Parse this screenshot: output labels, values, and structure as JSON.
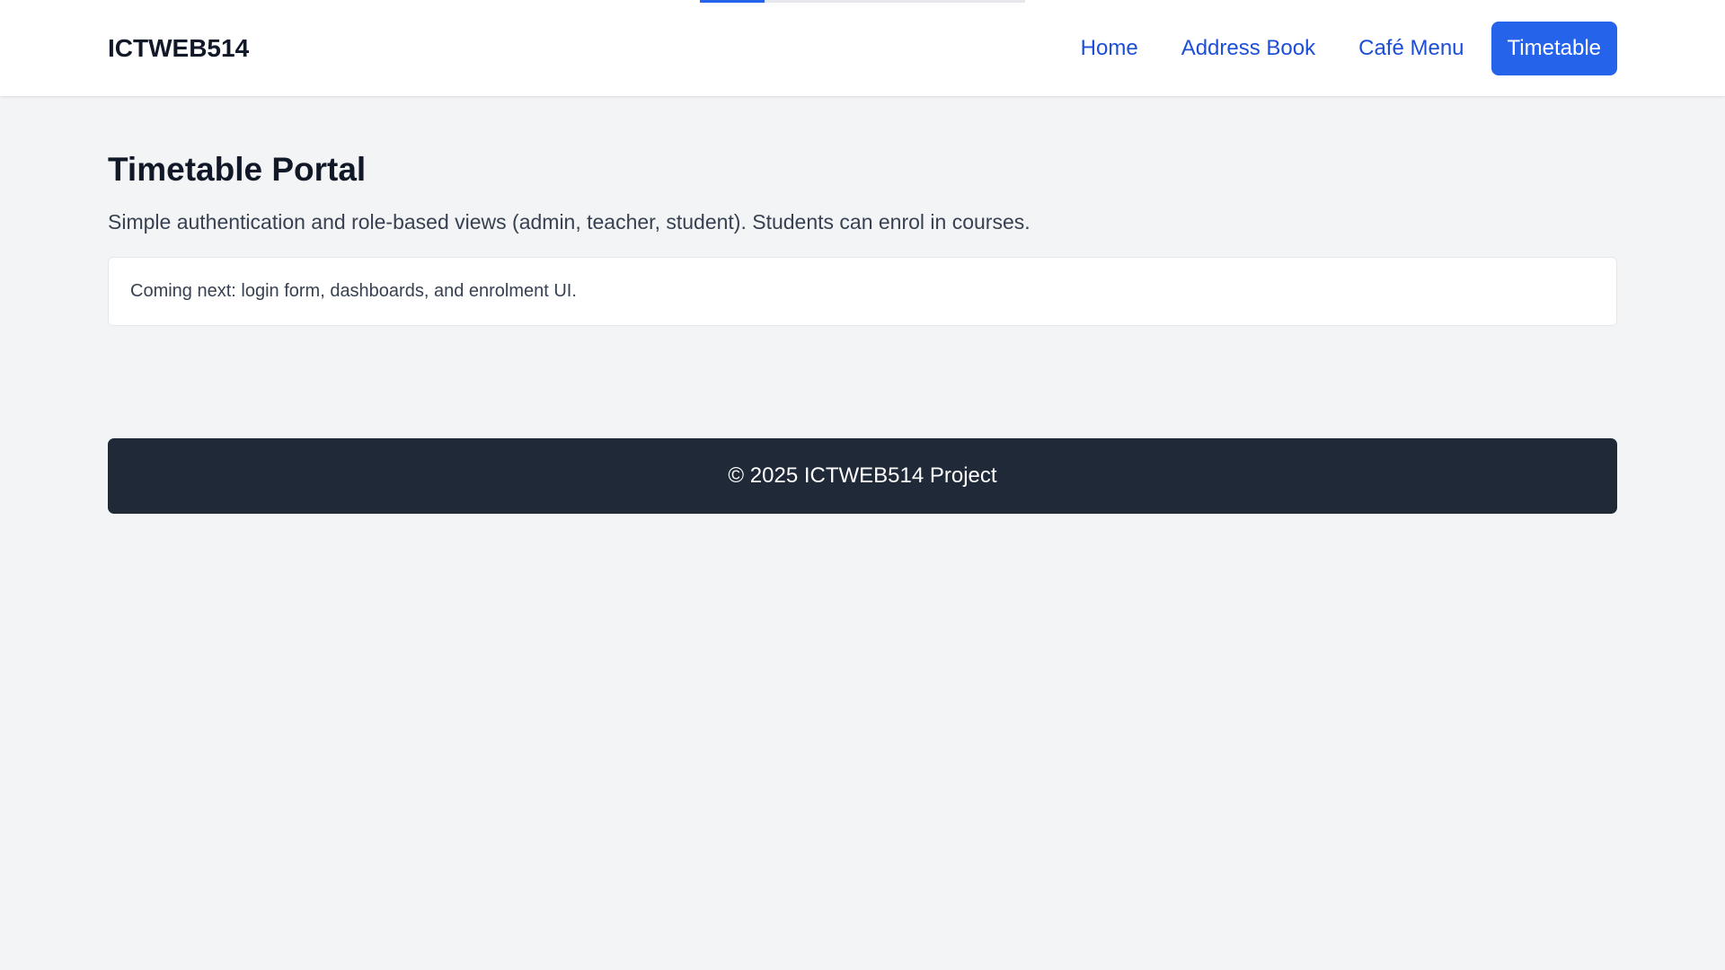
{
  "header": {
    "brand": "ICTWEB514",
    "nav": [
      {
        "label": "Home",
        "active": false
      },
      {
        "label": "Address Book",
        "active": false
      },
      {
        "label": "Café Menu",
        "active": false
      },
      {
        "label": "Timetable",
        "active": true
      }
    ]
  },
  "loading": {
    "progress": 0.2
  },
  "main": {
    "title": "Timetable Portal",
    "description": "Simple authentication and role-based views (admin, teacher, student). Students can enrol in courses.",
    "notice": "Coming next: login form, dashboards, and enrolment UI."
  },
  "footer": {
    "text": "© 2025 ICTWEB514 Project"
  },
  "colors": {
    "accent": "#2563eb",
    "link": "#1d4ed8",
    "background": "#f3f4f6",
    "footer_bg": "#1f2937"
  }
}
